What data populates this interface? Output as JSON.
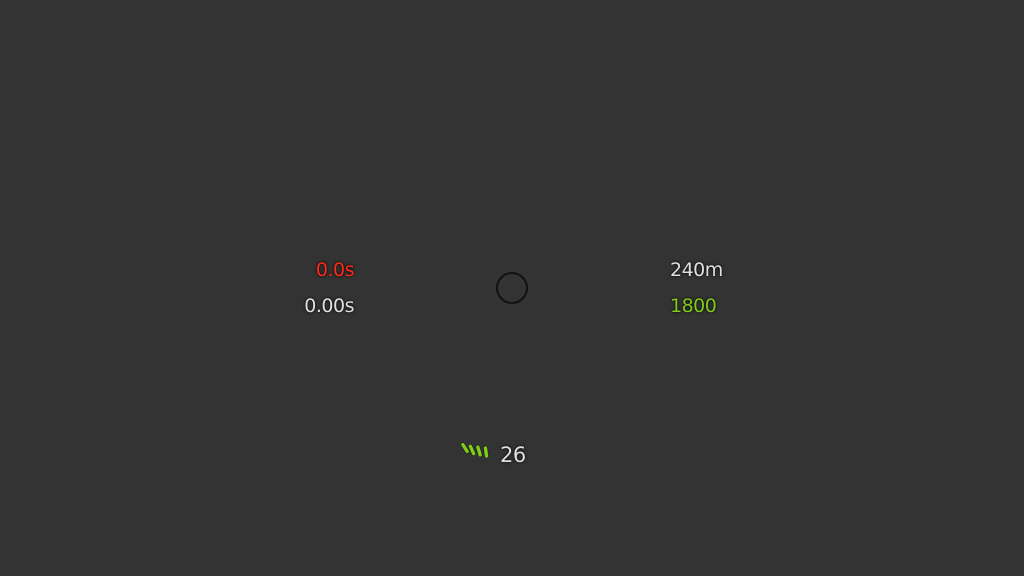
{
  "hud": {
    "timer_red": "0.0s",
    "timer_white": "0.00s",
    "distance": "240m",
    "score": "1800",
    "ammo_count": "26"
  },
  "colors": {
    "background": "#333333",
    "timer_red": "#ff2a1a",
    "text_white": "#e0e0e0",
    "score_green": "#7fcc1a",
    "ammo_icon_green": "#7fcc1a",
    "crosshair": "#111111"
  },
  "icons": {
    "crosshair": "crosshair-ring-icon",
    "ammo": "ammo-shells-icon"
  }
}
